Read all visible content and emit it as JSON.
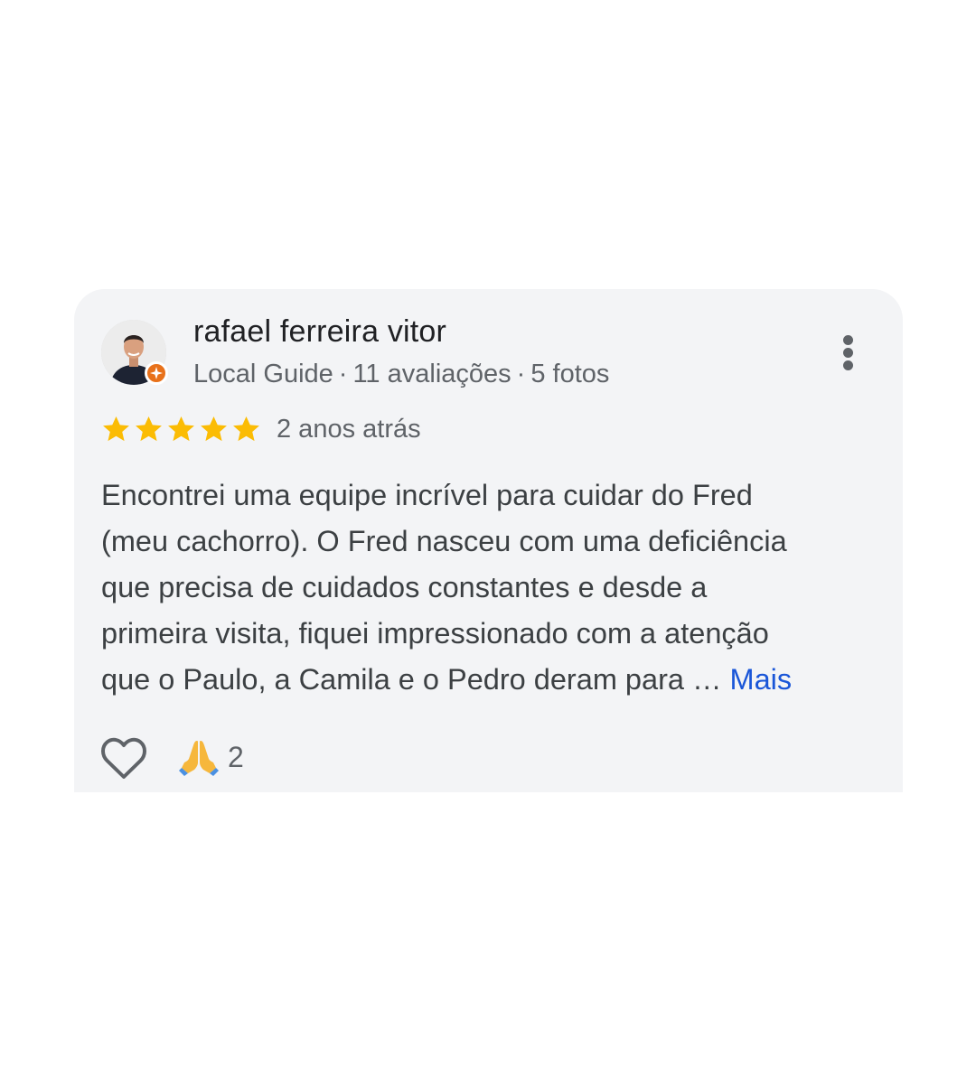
{
  "review": {
    "author": {
      "name": "rafael ferreira vitor",
      "level": "Local Guide",
      "reviews_count": "11 avaliações",
      "photos_count": "5 fotos",
      "separator": "·"
    },
    "rating": 5,
    "rating_max": 5,
    "star_color": "#fbbc04",
    "time_ago": "2 anos atrás",
    "text_lines": [
      "Encontrei uma equipe incrível para cuidar do Fred",
      "(meu cachorro). O Fred nasceu com uma deficiência",
      "que precisa de cuidados constantes e desde a",
      "primeira visita, fiquei impressionado com a atenção",
      "que o Paulo, a Camila e o Pedro deram para … "
    ],
    "more_label": "Mais",
    "reaction_emoji": "🙏",
    "reaction_count": "2"
  },
  "icons": {
    "avatar": "user-photo",
    "badge": "local-guide-badge-icon",
    "menu": "more-vert-icon",
    "star": "star-icon",
    "like": "heart-outline-icon",
    "reaction": "folded-hands-emoji"
  },
  "colors": {
    "card_bg": "#f3f4f6",
    "link": "#1a56d8",
    "badge": "#e8711a"
  }
}
